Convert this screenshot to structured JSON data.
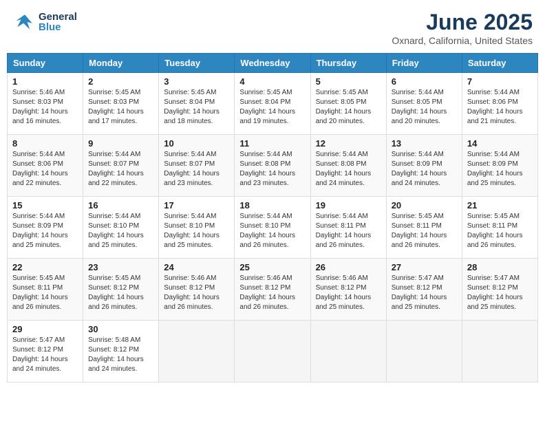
{
  "header": {
    "logo_general": "General",
    "logo_blue": "Blue",
    "month_title": "June 2025",
    "location": "Oxnard, California, United States"
  },
  "calendar": {
    "columns": [
      "Sunday",
      "Monday",
      "Tuesday",
      "Wednesday",
      "Thursday",
      "Friday",
      "Saturday"
    ],
    "weeks": [
      [
        {
          "day": "",
          "info": ""
        },
        {
          "day": "2",
          "info": "Sunrise: 5:45 AM\nSunset: 8:03 PM\nDaylight: 14 hours and 17 minutes."
        },
        {
          "day": "3",
          "info": "Sunrise: 5:45 AM\nSunset: 8:04 PM\nDaylight: 14 hours and 18 minutes."
        },
        {
          "day": "4",
          "info": "Sunrise: 5:45 AM\nSunset: 8:04 PM\nDaylight: 14 hours and 19 minutes."
        },
        {
          "day": "5",
          "info": "Sunrise: 5:45 AM\nSunset: 8:05 PM\nDaylight: 14 hours and 20 minutes."
        },
        {
          "day": "6",
          "info": "Sunrise: 5:44 AM\nSunset: 8:05 PM\nDaylight: 14 hours and 20 minutes."
        },
        {
          "day": "7",
          "info": "Sunrise: 5:44 AM\nSunset: 8:06 PM\nDaylight: 14 hours and 21 minutes."
        }
      ],
      [
        {
          "day": "8",
          "info": "Sunrise: 5:44 AM\nSunset: 8:06 PM\nDaylight: 14 hours and 22 minutes."
        },
        {
          "day": "9",
          "info": "Sunrise: 5:44 AM\nSunset: 8:07 PM\nDaylight: 14 hours and 22 minutes."
        },
        {
          "day": "10",
          "info": "Sunrise: 5:44 AM\nSunset: 8:07 PM\nDaylight: 14 hours and 23 minutes."
        },
        {
          "day": "11",
          "info": "Sunrise: 5:44 AM\nSunset: 8:08 PM\nDaylight: 14 hours and 23 minutes."
        },
        {
          "day": "12",
          "info": "Sunrise: 5:44 AM\nSunset: 8:08 PM\nDaylight: 14 hours and 24 minutes."
        },
        {
          "day": "13",
          "info": "Sunrise: 5:44 AM\nSunset: 8:09 PM\nDaylight: 14 hours and 24 minutes."
        },
        {
          "day": "14",
          "info": "Sunrise: 5:44 AM\nSunset: 8:09 PM\nDaylight: 14 hours and 25 minutes."
        }
      ],
      [
        {
          "day": "15",
          "info": "Sunrise: 5:44 AM\nSunset: 8:09 PM\nDaylight: 14 hours and 25 minutes."
        },
        {
          "day": "16",
          "info": "Sunrise: 5:44 AM\nSunset: 8:10 PM\nDaylight: 14 hours and 25 minutes."
        },
        {
          "day": "17",
          "info": "Sunrise: 5:44 AM\nSunset: 8:10 PM\nDaylight: 14 hours and 25 minutes."
        },
        {
          "day": "18",
          "info": "Sunrise: 5:44 AM\nSunset: 8:10 PM\nDaylight: 14 hours and 26 minutes."
        },
        {
          "day": "19",
          "info": "Sunrise: 5:44 AM\nSunset: 8:11 PM\nDaylight: 14 hours and 26 minutes."
        },
        {
          "day": "20",
          "info": "Sunrise: 5:45 AM\nSunset: 8:11 PM\nDaylight: 14 hours and 26 minutes."
        },
        {
          "day": "21",
          "info": "Sunrise: 5:45 AM\nSunset: 8:11 PM\nDaylight: 14 hours and 26 minutes."
        }
      ],
      [
        {
          "day": "22",
          "info": "Sunrise: 5:45 AM\nSunset: 8:11 PM\nDaylight: 14 hours and 26 minutes."
        },
        {
          "day": "23",
          "info": "Sunrise: 5:45 AM\nSunset: 8:12 PM\nDaylight: 14 hours and 26 minutes."
        },
        {
          "day": "24",
          "info": "Sunrise: 5:46 AM\nSunset: 8:12 PM\nDaylight: 14 hours and 26 minutes."
        },
        {
          "day": "25",
          "info": "Sunrise: 5:46 AM\nSunset: 8:12 PM\nDaylight: 14 hours and 26 minutes."
        },
        {
          "day": "26",
          "info": "Sunrise: 5:46 AM\nSunset: 8:12 PM\nDaylight: 14 hours and 25 minutes."
        },
        {
          "day": "27",
          "info": "Sunrise: 5:47 AM\nSunset: 8:12 PM\nDaylight: 14 hours and 25 minutes."
        },
        {
          "day": "28",
          "info": "Sunrise: 5:47 AM\nSunset: 8:12 PM\nDaylight: 14 hours and 25 minutes."
        }
      ],
      [
        {
          "day": "29",
          "info": "Sunrise: 5:47 AM\nSunset: 8:12 PM\nDaylight: 14 hours and 24 minutes."
        },
        {
          "day": "30",
          "info": "Sunrise: 5:48 AM\nSunset: 8:12 PM\nDaylight: 14 hours and 24 minutes."
        },
        {
          "day": "",
          "info": ""
        },
        {
          "day": "",
          "info": ""
        },
        {
          "day": "",
          "info": ""
        },
        {
          "day": "",
          "info": ""
        },
        {
          "day": "",
          "info": ""
        }
      ]
    ]
  },
  "week1_sun": {
    "day": "1",
    "info": "Sunrise: 5:46 AM\nSunset: 8:03 PM\nDaylight: 14 hours and 16 minutes."
  }
}
